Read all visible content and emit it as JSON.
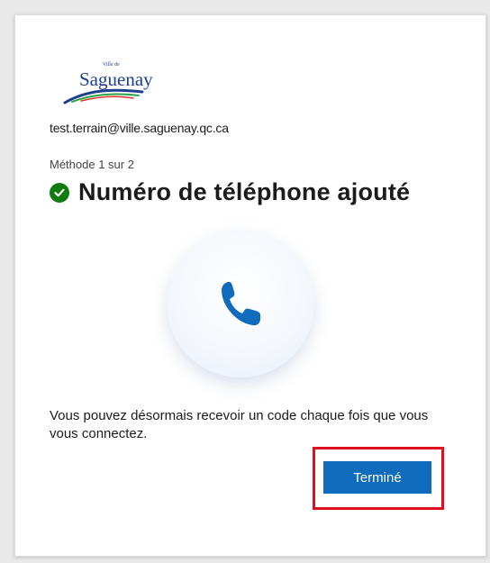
{
  "logo": {
    "small_text": "Ville de",
    "name": "Saguenay"
  },
  "account": {
    "email": "test.terrain@ville.saguenay.qc.ca"
  },
  "step": {
    "progress_label": "Méthode 1 sur 2",
    "title": "Numéro de téléphone ajouté"
  },
  "illustration": {
    "icon": "phone-icon"
  },
  "message": {
    "text": "Vous pouvez désormais recevoir un code chaque fois que vous vous connectez."
  },
  "actions": {
    "done_label": "Terminé"
  },
  "colors": {
    "primary_button": "#0f6cbd",
    "success": "#107c10",
    "highlight_outline": "#e01020",
    "phone_icon": "#0f6cbd"
  }
}
